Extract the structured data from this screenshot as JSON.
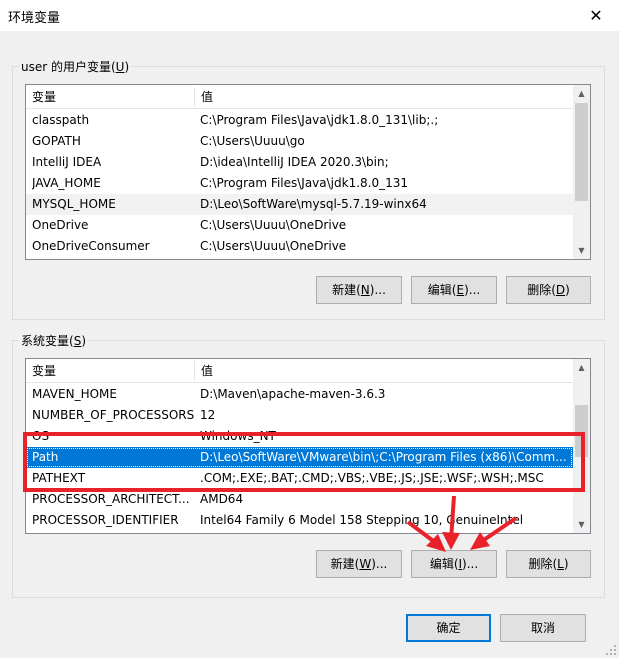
{
  "window": {
    "title": "环境变量",
    "close_symbol": "✕"
  },
  "user_vars": {
    "legend_prefix": "user 的用户变量(",
    "legend_key": "U",
    "legend_suffix": ")",
    "columns": [
      "变量",
      "值"
    ],
    "rows": [
      {
        "name": "classpath",
        "value": "C:\\Program Files\\Java\\jdk1.8.0_131\\lib;.;"
      },
      {
        "name": "GOPATH",
        "value": "C:\\Users\\Uuuu\\go"
      },
      {
        "name": "IntelliJ IDEA",
        "value": "D:\\idea\\IntelliJ IDEA 2020.3\\bin;"
      },
      {
        "name": "JAVA_HOME",
        "value": "C:\\Program Files\\Java\\jdk1.8.0_131"
      },
      {
        "name": "MYSQL_HOME",
        "value": "D:\\Leo\\SoftWare\\mysql-5.7.19-winx64"
      },
      {
        "name": "OneDrive",
        "value": "C:\\Users\\Uuuu\\OneDrive"
      },
      {
        "name": "OneDriveConsumer",
        "value": "C:\\Users\\Uuuu\\OneDrive"
      }
    ],
    "buttons": {
      "new": {
        "pre": "新建(",
        "key": "N",
        "post": ")..."
      },
      "edit": {
        "pre": "编辑(",
        "key": "E",
        "post": ")..."
      },
      "delete": {
        "pre": "删除(",
        "key": "D",
        "post": ")"
      }
    }
  },
  "system_vars": {
    "legend_prefix": "系统变量(",
    "legend_key": "S",
    "legend_suffix": ")",
    "columns": [
      "变量",
      "值"
    ],
    "rows": [
      {
        "name": "MAVEN_HOME",
        "value": "D:\\Maven\\apache-maven-3.6.3"
      },
      {
        "name": "NUMBER_OF_PROCESSORS",
        "value": "12"
      },
      {
        "name": "OS",
        "value": "Windows_NT"
      },
      {
        "name": "Path",
        "value": "D:\\Leo\\SoftWare\\VMware\\bin\\;C:\\Program Files (x86)\\Comm..."
      },
      {
        "name": "PATHEXT",
        "value": ".COM;.EXE;.BAT;.CMD;.VBS;.VBE;.JS;.JSE;.WSF;.WSH;.MSC"
      },
      {
        "name": "PROCESSOR_ARCHITECT...",
        "value": "AMD64"
      },
      {
        "name": "PROCESSOR_IDENTIFIER",
        "value": "Intel64 Family 6 Model 158 Stepping 10, GenuineIntel"
      }
    ],
    "selected_row": "Path",
    "buttons": {
      "new": {
        "pre": "新建(",
        "key": "W",
        "post": ")..."
      },
      "edit": {
        "pre": "编辑(",
        "key": "I",
        "post": ")..."
      },
      "delete": {
        "pre": "删除(",
        "key": "L",
        "post": ")"
      }
    }
  },
  "footer": {
    "ok": "确定",
    "cancel": "取消"
  },
  "colors": {
    "selection": "#0078d7",
    "annotation_red": "#e8212b"
  }
}
